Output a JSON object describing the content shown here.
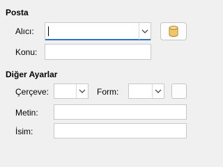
{
  "mail_section": {
    "heading": "Posta",
    "recipient_label": "Alıcı:",
    "recipient_value": "",
    "subject_label": "Konu:",
    "subject_value": ""
  },
  "other_section": {
    "heading": "Diğer Ayarlar",
    "frame_label": "Çerçeve:",
    "frame_value": "",
    "form_label": "Form:",
    "form_value": "",
    "text_label": "Metin:",
    "text_value": "",
    "name_label": "İsim:",
    "name_value": ""
  },
  "icons": {
    "address_book": "database-icon",
    "dropdown": "chevron-down-icon"
  },
  "colors": {
    "focus_accent": "#2e6fbf",
    "database_icon": "#f2c66d"
  }
}
